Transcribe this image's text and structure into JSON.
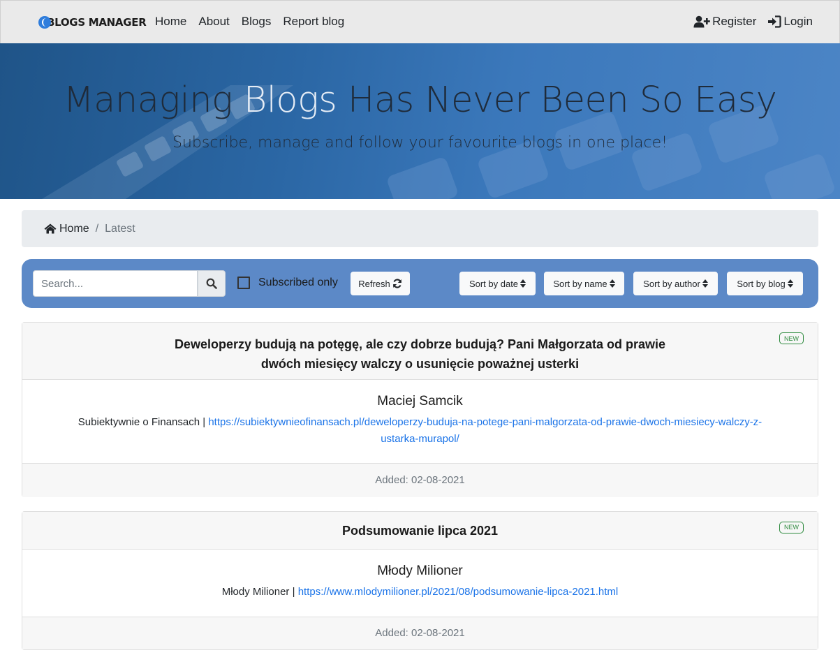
{
  "navbar": {
    "brand": "BLOGS MANAGER",
    "links": [
      "Home",
      "About",
      "Blogs",
      "Report blog"
    ],
    "register": "Register",
    "login": "Login"
  },
  "hero": {
    "title_part1": "Managing ",
    "title_accent": "Blogs",
    "title_part2": " Has Never Been So Easy",
    "subtitle": "Subscribe, manage and follow your favourite blogs in one place!"
  },
  "breadcrumb": {
    "home": "Home",
    "separator": "/",
    "current": "Latest"
  },
  "toolbar": {
    "search_placeholder": "Search...",
    "subscribed_label": "Subscribed only",
    "subscribed_checked": false,
    "refresh_label": "Refresh",
    "sort_date": "Sort by date",
    "sort_name": "Sort by name",
    "sort_author": "Sort by author",
    "sort_blog": "Sort by blog"
  },
  "posts": [
    {
      "title_line1": "Deweloperzy budują na potęgę, ale czy dobrze budują? Pani Małgorzata od prawie",
      "title_line2": "dwóch miesięcy walczy o usunięcie poważnej usterki",
      "badge": "NEW",
      "author": "Maciej Samcik",
      "blog": "Subiektywnie o Finansach",
      "separator": "|",
      "url_line1": "https://subiektywnieofinansach.pl/deweloperzy-buduja-na-potege-pani-malgorzata-od-prawie-dwoch-miesiecy-walczy-z-",
      "url_line2": "ustarka-murapol/",
      "added": "Added: 02-08-2021"
    },
    {
      "title": "Podsumowanie lipca 2021",
      "badge": "NEW",
      "author": "Młody Milioner",
      "blog": "Młody Milioner",
      "separator": "|",
      "url": "https://www.mlodymilioner.pl/2021/08/podsumowanie-lipca-2021.html",
      "added": "Added: 02-08-2021"
    }
  ],
  "colors": {
    "navbar_bg": "#eaeaea",
    "toolbar_bg": "#5c89c7",
    "link": "#1a73e8",
    "badge_green": "#2e8b3e"
  }
}
